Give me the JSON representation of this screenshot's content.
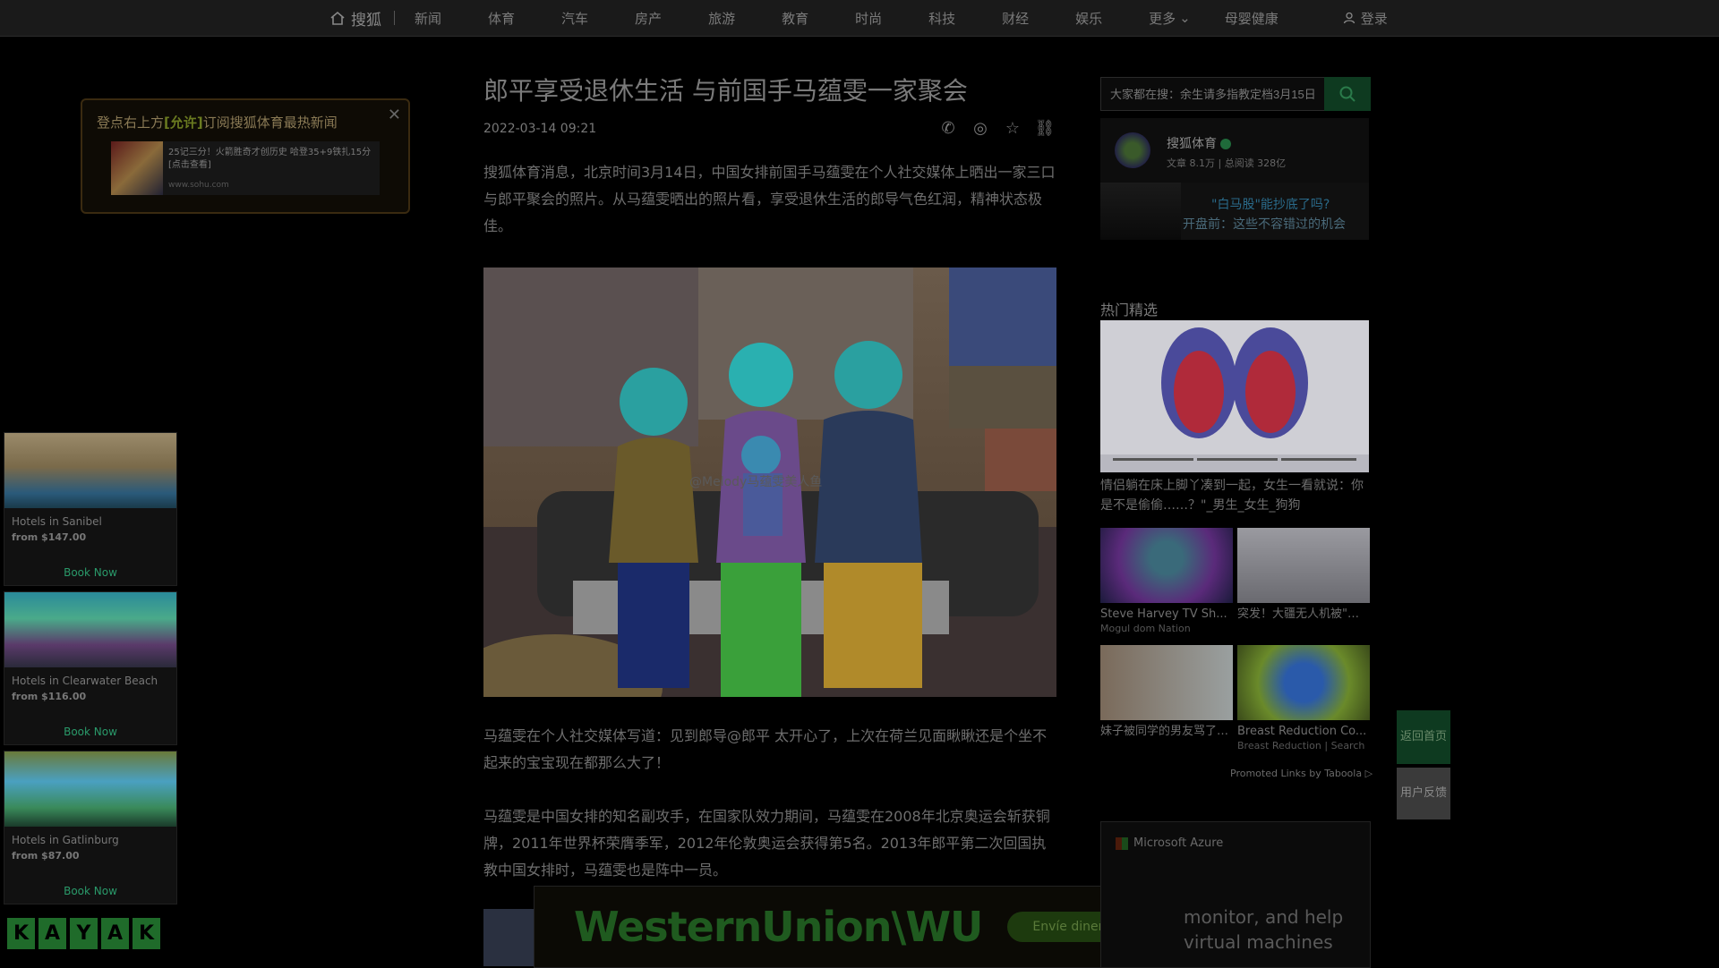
{
  "nav": {
    "logo": "搜狐",
    "items": [
      "新闻",
      "体育",
      "汽车",
      "房产",
      "旅游",
      "教育",
      "时尚",
      "科技",
      "财经",
      "娱乐"
    ],
    "more": "更多",
    "mother_baby": "母婴健康",
    "login": "登录"
  },
  "popup": {
    "prefix": "登点右上方",
    "highlight": "[允许]",
    "suffix": "订阅搜狐体育最热新闻",
    "card_text": "25记三分！火箭胜奇才创历史 哈登35+9铁扎15分[点击查看]",
    "card_url": "www.sohu.com"
  },
  "left_ads": [
    {
      "name": "Hotels in Sanibel",
      "price": "from $147.00",
      "button": "Book Now"
    },
    {
      "name": "Hotels in Clearwater Beach",
      "price": "from $116.00",
      "button": "Book Now"
    },
    {
      "name": "Hotels in Gatlinburg",
      "price": "from $87.00",
      "button": "Book Now"
    }
  ],
  "kayak": [
    "K",
    "A",
    "Y",
    "A",
    "K"
  ],
  "article": {
    "title": "郎平享受退休生活 与前国手马蕴雯一家聚会",
    "date": "2022-03-14 09:21",
    "p1": "搜狐体育消息，北京时间3月14日，中国女排前国手马蕴雯在个人社交媒体上晒出一家三口与郎平聚会的照片。从马蕴雯晒出的照片看，享受退休生活的郎导气色红润，精神状态极佳。",
    "photo_caption": "@Melody马蕴雯美人鱼",
    "p2": "马蕴雯在个人社交媒体写道：见到郎导@郎平 太开心了，上次在荷兰见面瞅瞅还是个坐不起来的宝宝现在都那么大了！",
    "p3": "马蕴雯是中国女排的知名副攻手，在国家队效力期间，马蕴雯在2008年北京奥运会斩获铜牌，2011年世界杯荣膺季军，2012年伦敦奥运会获得第5名。2013年郎平第二次回国执教中国女排时，马蕴雯也是阵中一员。"
  },
  "wu_banner": {
    "logo": "WesternUnion\\WU",
    "button": "Envíe dinero"
  },
  "search": {
    "placeholder": "大家都在搜：余生请多指教定档3月15日"
  },
  "author": {
    "name": "搜狐体育",
    "stats": "文章   8.1万   |   总阅读   328亿"
  },
  "author_banner": {
    "line1": "\"白马股\"能抄底了吗?",
    "line2": "开盘前：这些不容错过的机会"
  },
  "hot": {
    "title": "热门精选",
    "main_caption": "情侣躺在床上脚丫凑到一起，女生一看就说：你是不是偷偷……？\"_男生_女生_狗狗",
    "cards": [
      {
        "caption": "Steve Harvey TV Sh...",
        "source": "Mogul dom Nation"
      },
      {
        "caption": "突发！大疆无人机被\"升级制裁\"：美国设计软...",
        "source": ""
      },
      {
        "caption": "妹子被同学的男友骂了，这样做是不是有...",
        "source": ""
      },
      {
        "caption": "Breast Reduction Co...",
        "source": "Breast Reduction | Search"
      }
    ]
  },
  "taboola": "Promoted Links by Taboola",
  "azure": {
    "brand": "Microsoft Azure",
    "text": "monitor, and help virtual machines "
  },
  "float": {
    "back": "返回首页",
    "feedback": "用户反馈"
  }
}
